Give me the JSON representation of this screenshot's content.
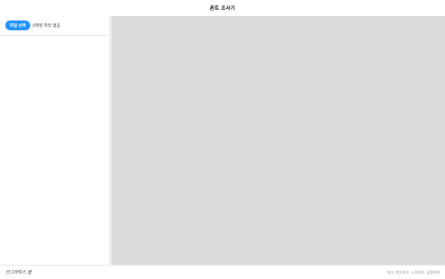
{
  "header": {
    "title": "폰트 조사기"
  },
  "sidebar": {
    "select_file_label": "파일 선택",
    "selected_file_text": "선택된 파일 없음"
  },
  "footer": {
    "brand": "안그라픽스 랩",
    "meta": "자고, 안논하고, 느릿하고, 꼼꼼하게"
  },
  "colors": {
    "accent": "#1e90ff",
    "preview_background": "#dcdcdc"
  }
}
